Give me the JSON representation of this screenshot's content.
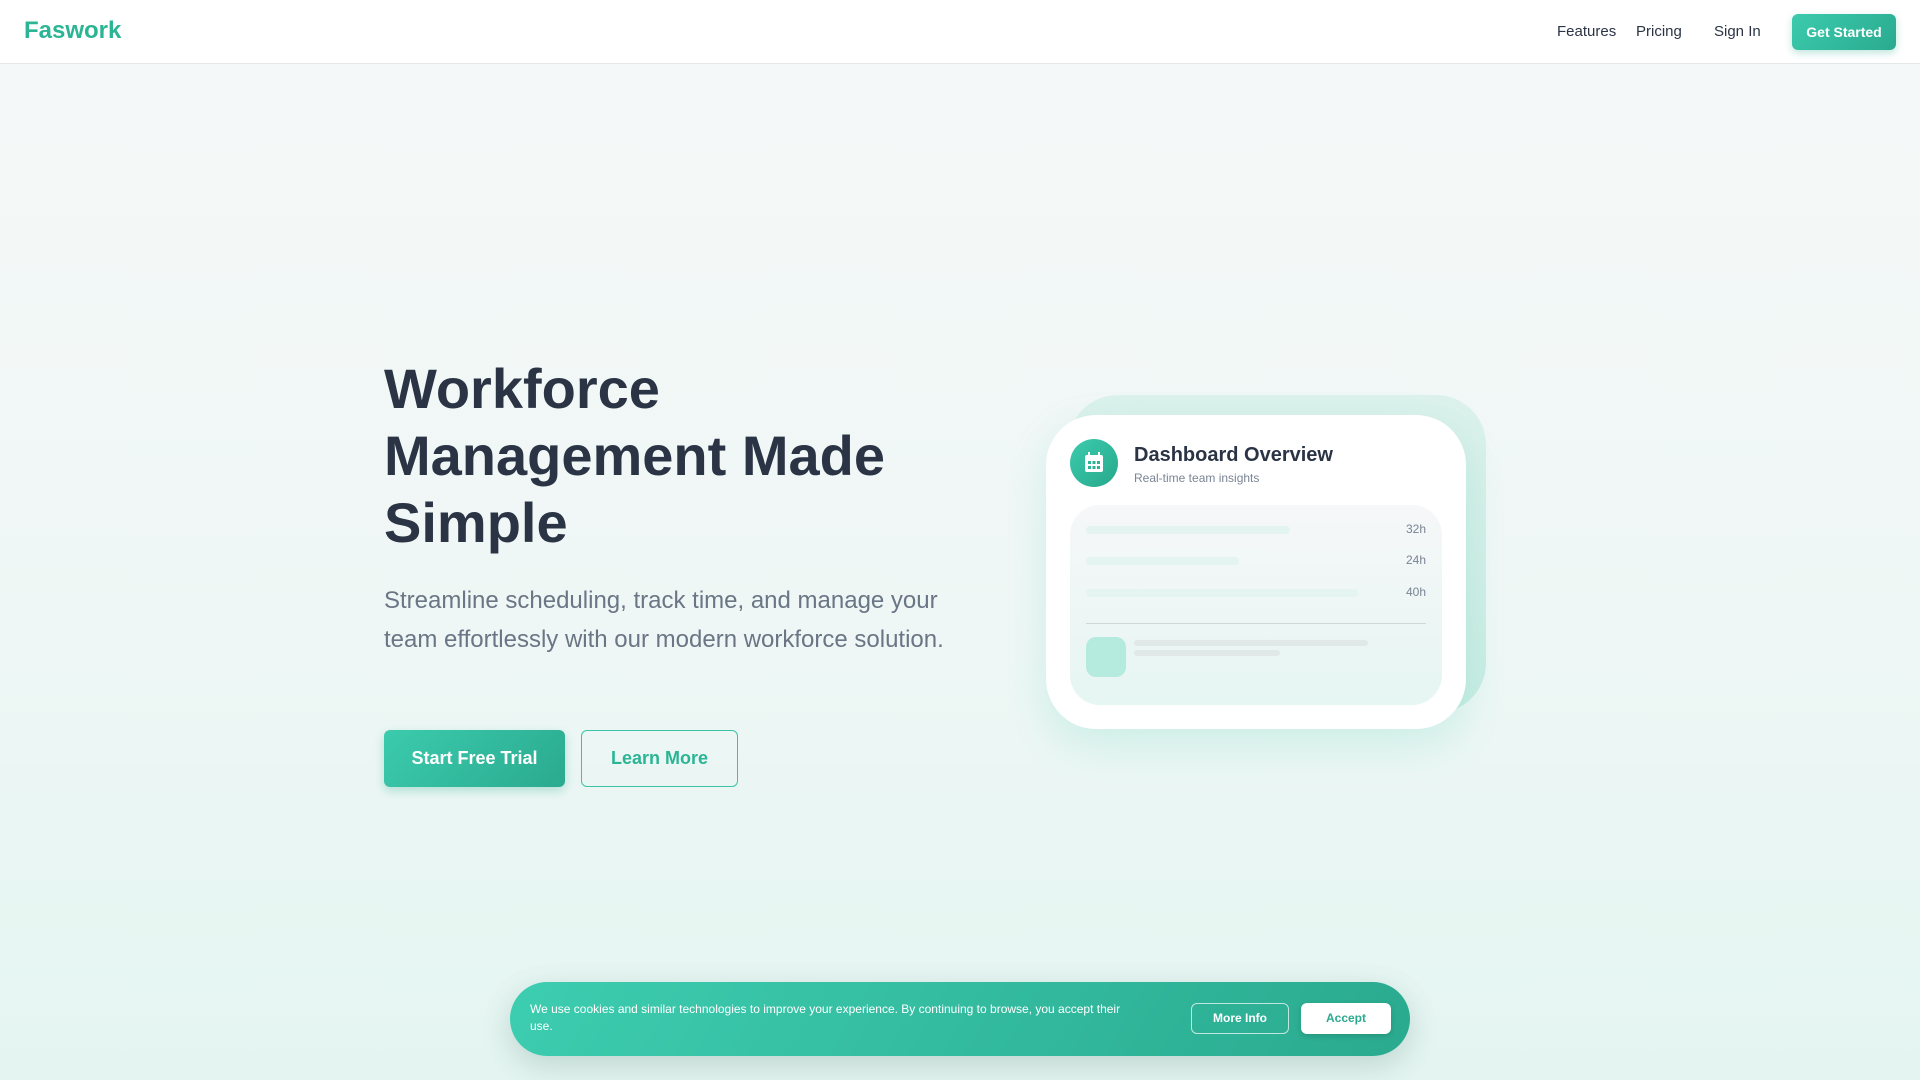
{
  "nav": {
    "logo": "Faswork",
    "links": [
      "Features",
      "Pricing",
      "Sign In"
    ],
    "cta": "Get Started"
  },
  "hero": {
    "title": "Workforce Management Made Simple",
    "subtitle": "Streamline scheduling, track time, and manage your team effortlessly with our modern workforce solution.",
    "primary": "Start Free Trial",
    "secondary": "Learn More"
  },
  "dashboard": {
    "title": "Dashboard Overview",
    "subtitle": "Real-time team insights",
    "rows": [
      {
        "label": "32h",
        "fill": 0.6
      },
      {
        "label": "24h",
        "fill": 0.45
      },
      {
        "label": "40h",
        "fill": 0.8
      }
    ]
  },
  "cookie": {
    "text": "We use cookies and similar technologies to improve your experience. By continuing to browse, you accept their use.",
    "more": "More Info",
    "accept": "Accept"
  },
  "colors": {
    "brand": "#2bb594",
    "text": "#2b3445"
  }
}
